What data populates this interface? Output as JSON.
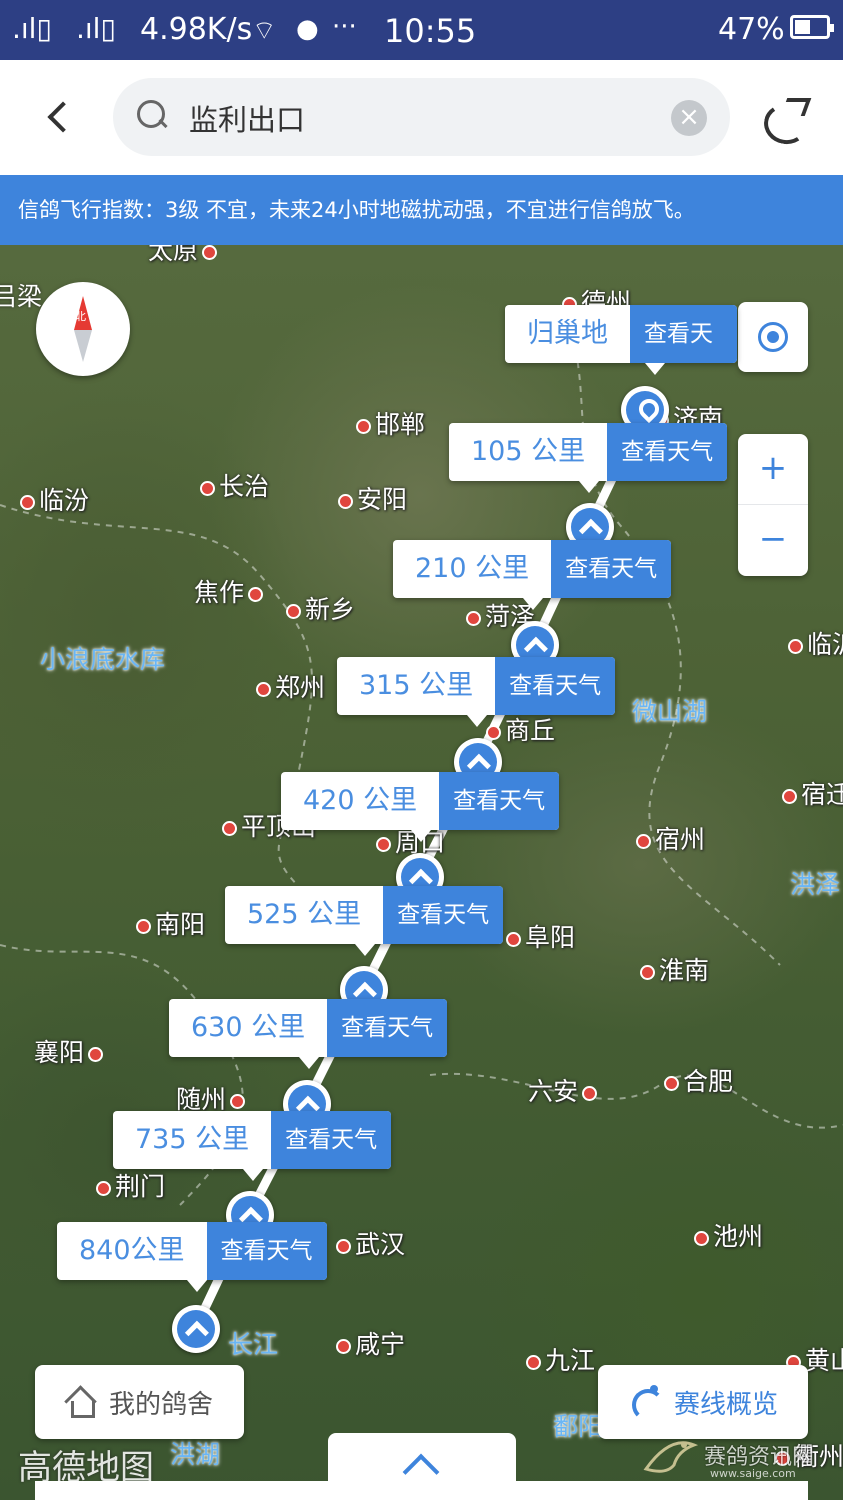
{
  "status_bar": {
    "signal1": ".ıl▯",
    "signal2": ".ıl▯",
    "network_speed": "4.98K/s",
    "dots": "···",
    "time": "10:55",
    "battery": "47%"
  },
  "header": {
    "search_value": "监利出口",
    "clear_icon": "×"
  },
  "notice": {
    "text": "信鸽飞行指数：3级 不宜，未来24小时地磁扰动强，不宜进行信鸽放飞。"
  },
  "map": {
    "compass_label": "北",
    "zoom_in": "+",
    "zoom_out": "−",
    "route": {
      "home": {
        "label": "归巢地",
        "weather_label": "查看天"
      },
      "waypoints": [
        {
          "distance": "105 公里",
          "weather_label": "查看天气"
        },
        {
          "distance": "210 公里",
          "weather_label": "查看天气"
        },
        {
          "distance": "315 公里",
          "weather_label": "查看天气"
        },
        {
          "distance": "420 公里",
          "weather_label": "查看天气"
        },
        {
          "distance": "525 公里",
          "weather_label": "查看天气"
        },
        {
          "distance": "630 公里",
          "weather_label": "查看天气"
        },
        {
          "distance": "735 公里",
          "weather_label": "查看天气"
        },
        {
          "distance": "840公里",
          "weather_label": "查看天气"
        }
      ]
    },
    "cities": [
      "太原",
      "吕梁",
      "德州",
      "济南",
      "邯郸",
      "长治",
      "临汾",
      "安阳",
      "焦作",
      "新乡",
      "菏泽",
      "郑州",
      "商丘",
      "平顶山",
      "周口",
      "宿州",
      "宿迁",
      "南阳",
      "阜阳",
      "淮南",
      "襄阳",
      "随州",
      "六安",
      "合肥",
      "荆门",
      "武汉",
      "池州",
      "咸宁",
      "九江",
      "黄山",
      "临沂",
      "衢州"
    ],
    "waters": [
      "小浪底水库",
      "微山湖",
      "洪泽",
      "长江",
      "鄱阳",
      "洪湖"
    ],
    "map_logo": "高德地图"
  },
  "bottom": {
    "my_loft_label": "我的鸽舍",
    "overview_label": "赛线概览"
  },
  "watermark": {
    "text": "赛鸽资讯网",
    "url": "www.saige.com"
  }
}
